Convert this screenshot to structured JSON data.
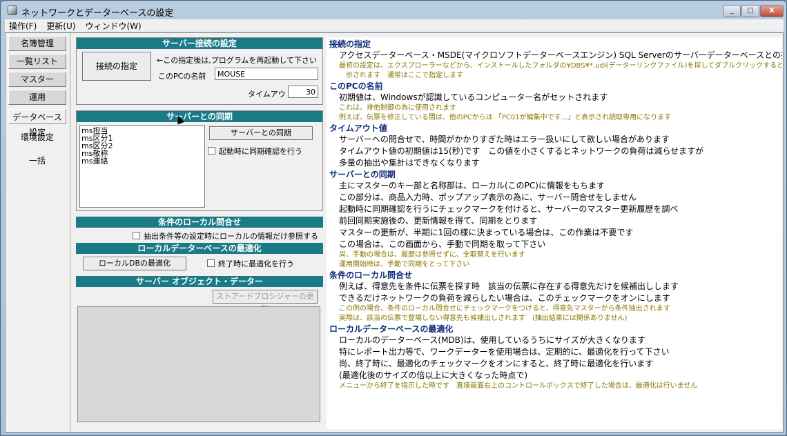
{
  "window": {
    "title": "ネットワークとデーターベースの設定",
    "min": "_",
    "max": "□",
    "close": "X"
  },
  "menubar": [
    "操作(F)",
    "更新(U)",
    "ウィンドウ(W)"
  ],
  "sidebar": {
    "items": [
      "名簿管理",
      "一覧リスト",
      "マスター",
      "運用",
      "データベース設定",
      "環境設定",
      "一括"
    ],
    "active_index": 4
  },
  "server_connect": {
    "header": "サーバー接続の設定",
    "connect_button": "接続の指定",
    "note": "←この指定後は,プログラムを再起動して下さい",
    "pc_name_label": "このPCの名前",
    "pc_name_value": "MOUSE",
    "timeout_label": "タイムアウト値",
    "timeout_value": "30"
  },
  "sync": {
    "header": "サーバーとの同期",
    "list": [
      "ms担当",
      "ms区分1",
      "ms区分2",
      "ms敬称",
      "ms連絡"
    ],
    "sync_button": "サーバーとの同期",
    "startup_check_label": "起動時に同期確認を行う"
  },
  "local_query": {
    "header": "条件のローカル問合せ",
    "check_label": "抽出条件等の設定時にローカルの情報だけ参照する"
  },
  "optimize": {
    "header": "ローカルデーターベースの最適化",
    "button": "ローカルDBの最適化",
    "check_label": "終了時に最適化を行う"
  },
  "server_object": {
    "header": "サーバー オブジェクト・データー",
    "button": "ストアードプロシジャーの更新"
  },
  "help": [
    {
      "type": "h",
      "text": "接続の指定"
    },
    {
      "type": "l",
      "text": "アクセスデーターベース・MSDE(マイクロソフトデーターベースエンジン) SQL Serverのサーバーデーターベースとの接続を指定します"
    },
    {
      "type": "n",
      "text": "最初の設定は、エクスプローラーなどから、インストールしたフォルダの¥DBS¥*.udl(データーリンクファイル)を探してダブルクリックすると、接続設定のダイアログが表"
    },
    {
      "type": "n",
      "text": "　示されます　通常はここで指定します"
    },
    {
      "type": "h",
      "text": "このPCの名前"
    },
    {
      "type": "l",
      "text": "初期値は、Windowsが認識しているコンピューター名がセットされます"
    },
    {
      "type": "n",
      "text": "これは、排他制御の為に使用されます"
    },
    {
      "type": "n",
      "text": "例えば、伝票を修正している間は、他のPCからは 「PC01が編集中です...」と表示され読取専用になります"
    },
    {
      "type": "h",
      "text": "タイムアウト値"
    },
    {
      "type": "l",
      "text": "サーバーへの問合せで、時間がかかりすぎた時はエラー扱いにして欲しい場合があります"
    },
    {
      "type": "l",
      "text": "タイムアウト値の初期値は15(秒)です　この値を小さくするとネットワークの負荷は減らせますが"
    },
    {
      "type": "l",
      "text": "多量の抽出や集計はできなくなります"
    },
    {
      "type": "h",
      "text": "サーバーとの同期"
    },
    {
      "type": "l",
      "text": "主にマスターのキー部と名称部は、ローカル(このPC)に情報をもちます"
    },
    {
      "type": "l",
      "text": "この部分は、商品入力時、ポップアップ表示の為に、サーバー問合せをしません"
    },
    {
      "type": "l",
      "text": "起動時に同期確認を行うにチェックマークを付けると、サーバーのマスター更新履歴を調べ"
    },
    {
      "type": "l",
      "text": "前回同期実施後の、更新情報を得て、同期をとります"
    },
    {
      "type": "l",
      "text": "マスターの更新が、半期に1回の様に決まっている場合は、この作業は不要です"
    },
    {
      "type": "l",
      "text": "この場合は、この画面から、手動で同期を取って下さい"
    },
    {
      "type": "n",
      "text": "尚、手動の場合は、履歴は参照せずに、全取替えを行います"
    },
    {
      "type": "n",
      "text": "運用開始時は、手動で同期をとって下さい"
    },
    {
      "type": "h",
      "text": "条件のローカル問合せ"
    },
    {
      "type": "l",
      "text": "例えば、得意先を条件に伝票を探す時　該当の伝票に存在する得意先だけを候補出しします"
    },
    {
      "type": "l",
      "text": "できるだけネットワークの負荷を減らしたい場合は、このチェックマークをオンにします"
    },
    {
      "type": "n",
      "text": "この例の場合、条件のローカル問合せにチェックマークをつけると、得意先マスターから条件抽出されます"
    },
    {
      "type": "n",
      "text": "実際は、該当の伝票で登場しない得意先も候補出しされます　(抽出結果には関係ありません)"
    },
    {
      "type": "h",
      "text": "ローカルデーターベースの最適化"
    },
    {
      "type": "l",
      "text": "ローカルのデーターベース(MDB)は、使用しているうちにサイズが大きくなります"
    },
    {
      "type": "l",
      "text": "特にレポート出力等で、ワークデーターを使用場合は、定期的に、最適化を行って下さい"
    },
    {
      "type": "l",
      "text": "尚、終了時に、最適化のチェックマークをオンにすると、終了時に最適化を行います"
    },
    {
      "type": "l",
      "text": "(最適化後のサイズの倍以上に大きくなった時点で)"
    },
    {
      "type": "n",
      "text": "メニューから終了を指示した時です　直接画面右上のコントロールボックスで終了した場合は、最適化は行いません"
    }
  ]
}
